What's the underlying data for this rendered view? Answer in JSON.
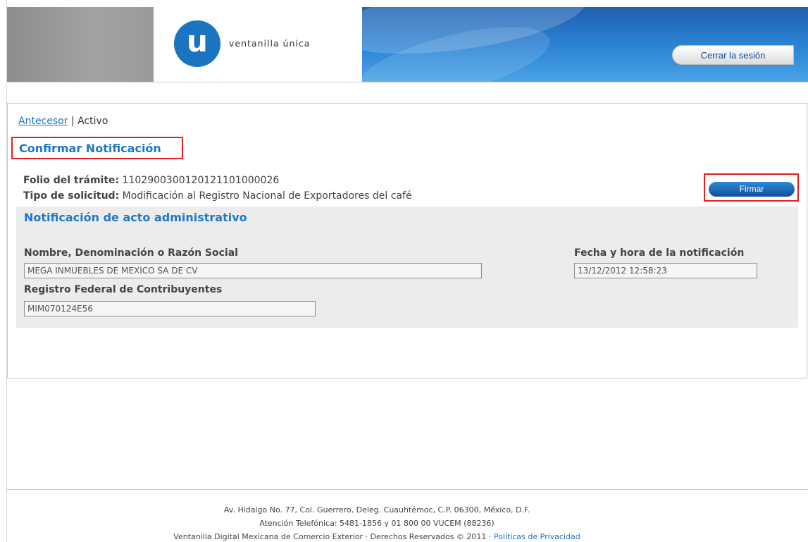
{
  "header": {
    "logo_letter": "u",
    "logo_text": "ventanilla única",
    "logout_label": "Cerrar la sesión"
  },
  "breadcrumb": {
    "link": "Antecesor",
    "separator": "|",
    "current": "Activo"
  },
  "page": {
    "title": "Confirmar Notificación",
    "folio_label": "Folio del trámite:",
    "folio_value": "1102900300120121101000026",
    "tipo_label": "Tipo de solicitud:",
    "tipo_value": "Modificación al Registro Nacional de Exportadores del café",
    "sign_label": "Firmar"
  },
  "notification": {
    "title": "Notificación de acto administrativo",
    "name_label": "Nombre, Denominación o Razón Social",
    "name_value": "MEGA INMUEBLES DE MEXICO SA DE CV",
    "date_label": "Fecha y hora de la notificación",
    "date_value": "13/12/2012 12:58:23",
    "rfc_label": "Registro Federal de Contribuyentes",
    "rfc_value": "MIM070124E56"
  },
  "footer": {
    "address": "Av. Hidalgo No. 77, Col. Guerrero, Deleg. Cuauhtémoc, C.P. 06300, México, D.F.",
    "phone": "Atención Telefónica: 5481-1856 y 01 800 00 VUCEM (88236)",
    "rights": "Ventanilla Digital Mexicana de Comercio Exterior · Derechos Reservados © 2011 ·",
    "privacy_link": "Políticas de Privacidad"
  }
}
